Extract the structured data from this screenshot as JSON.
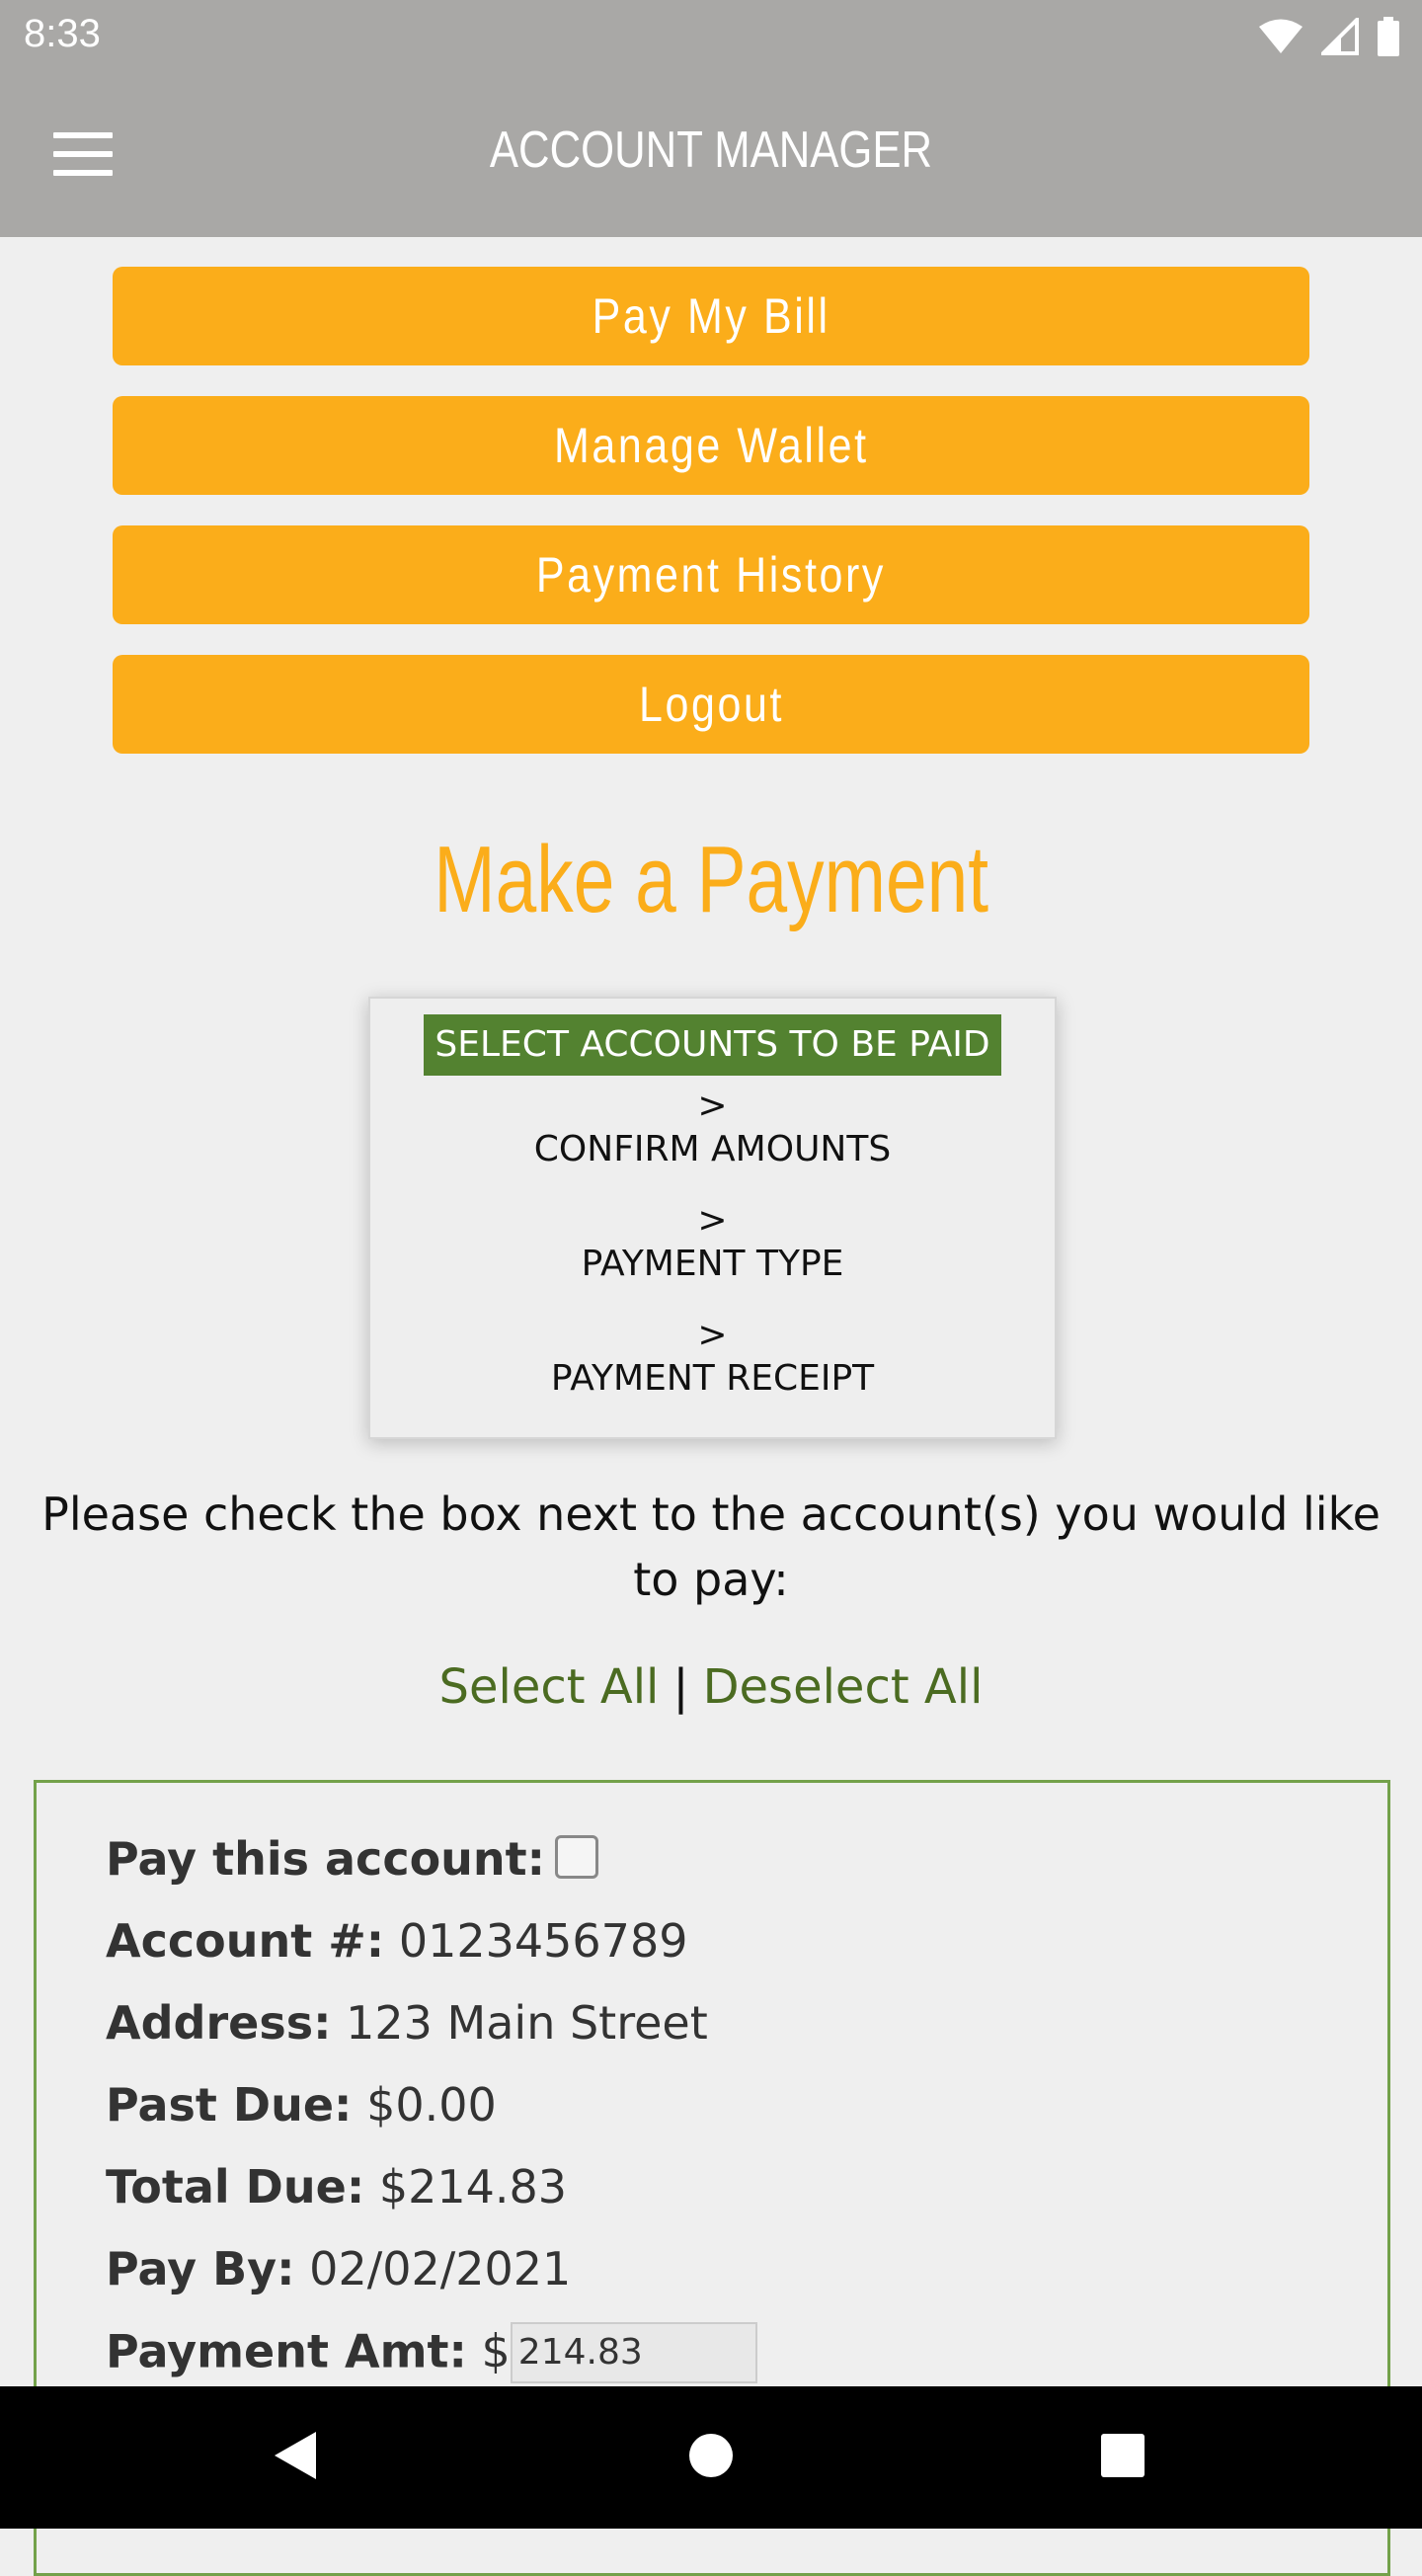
{
  "status_bar": {
    "time": "8:33"
  },
  "app_bar": {
    "title": "ACCOUNT MANAGER"
  },
  "buttons": {
    "pay_bill": "Pay My Bill",
    "manage_wallet": "Manage Wallet",
    "payment_history": "Payment History",
    "logout": "Logout"
  },
  "heading": "Make a Payment",
  "steps": {
    "step1": "SELECT ACCOUNTS TO BE PAID",
    "step2": "CONFIRM AMOUNTS",
    "step3": "PAYMENT TYPE",
    "step4": "PAYMENT RECEIPT",
    "separator": ">"
  },
  "instructions": "Please check the box next to the account(s) you would like to pay:",
  "select": {
    "all": "Select All",
    "divider": "|",
    "none": "Deselect All"
  },
  "account": {
    "pay_label": "Pay this account:",
    "number_label": "Account #:",
    "number": "0123456789",
    "address_label": "Address:",
    "address": "123 Main Street",
    "past_due_label": "Past Due:",
    "past_due": "$0.00",
    "total_due_label": "Total Due:",
    "total_due": "$214.83",
    "pay_by_label": "Pay By:",
    "pay_by": "02/02/2021",
    "payment_amt_label": "Payment Amt:",
    "currency": "$",
    "payment_amt": "214.83"
  },
  "colors": {
    "accent": "#fbad1a",
    "appbar": "#a9a8a6",
    "active_step": "#538230",
    "link": "#4b6b21",
    "card_border": "#73a14a"
  }
}
